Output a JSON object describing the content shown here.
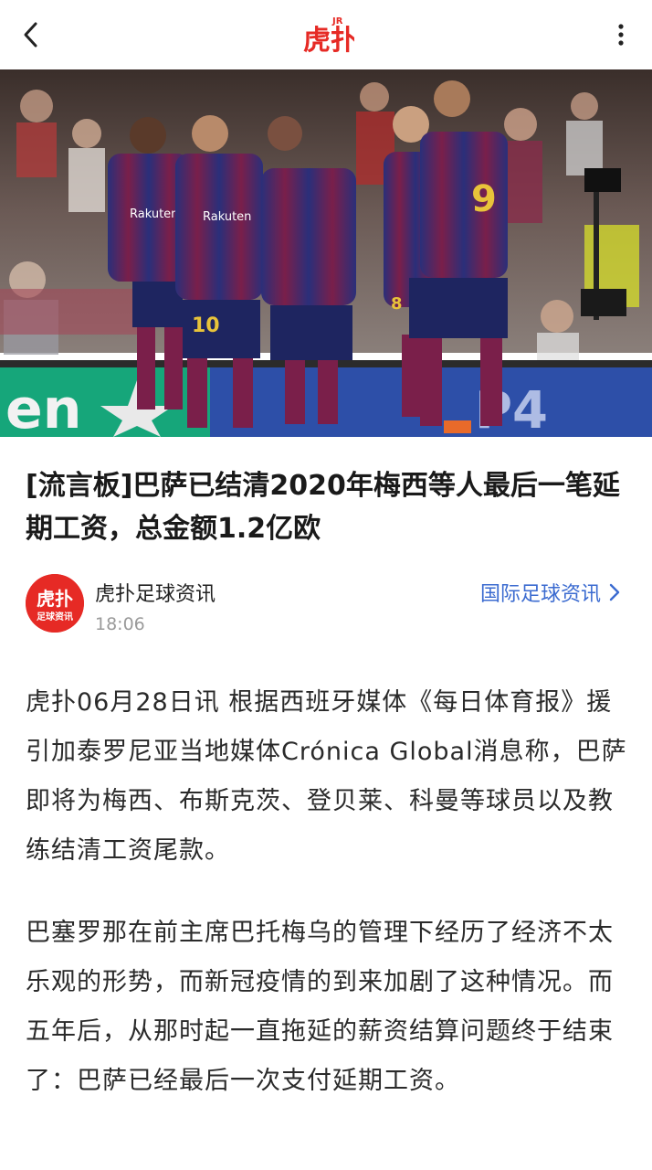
{
  "app": {
    "logo_text": "虎扑",
    "logo_badge": "JR"
  },
  "article": {
    "title": "[流言板]巴萨已结清2020年梅西等人最后一笔延期工资，总金额1.2亿欧",
    "author": {
      "name": "虎扑足球资讯",
      "avatar_text_top": "虎扑",
      "avatar_text_bottom": "足球资讯",
      "time": "18:06"
    },
    "channel_link": "国际足球资讯",
    "paragraphs": [
      "虎扑06月28日讯 根据西班牙媒体《每日体育报》援引加泰罗尼亚当地媒体Crónica Global消息称，巴萨即将为梅西、布斯克茨、登贝莱、科曼等球员以及教练结清工资尾款。",
      "巴塞罗那在前主席巴托梅乌的管理下经历了经济不太乐观的形势，而新冠疫情的到来加剧了这种情况。而五年后，从那时起一直拖延的薪资结算问题终于结束了：巴萨已经最后一次支付延期工资。"
    ]
  },
  "hero": {
    "board_text": "en",
    "board_text_right": "P4",
    "shirt_numbers": [
      "10",
      "9",
      "8"
    ],
    "sponsor_text": "Rakuten"
  },
  "colors": {
    "brand_red": "#e62a25",
    "link_blue": "#3b6bd0",
    "text": "#2a2a2a",
    "muted": "#9a9a9a"
  }
}
